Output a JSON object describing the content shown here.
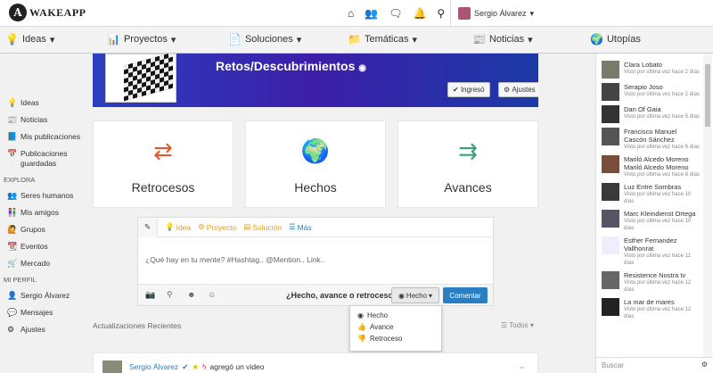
{
  "app": {
    "logo_letter": "A",
    "logo_text": "WAKEAPP"
  },
  "topbar": {
    "icons": [
      "home-icon",
      "users-icon",
      "chat-icon",
      "bell-icon",
      "search-icon"
    ],
    "user_name": "Sergio Álvarez"
  },
  "nav": [
    {
      "label": "Ideas",
      "icon": "lightbulb-icon"
    },
    {
      "label": "Proyectos",
      "icon": "chart-icon"
    },
    {
      "label": "Soluciones",
      "icon": "document-icon"
    },
    {
      "label": "Temáticas",
      "icon": "folder-icon"
    },
    {
      "label": "Noticias",
      "icon": "newspaper-icon"
    },
    {
      "label": "Utopías",
      "icon": "globe-icon"
    }
  ],
  "sidebar": {
    "items": [
      {
        "label": "Ideas",
        "icon": "💡"
      },
      {
        "label": "Noticias",
        "icon": "📰"
      },
      {
        "label": "Mis publicaciones",
        "icon": "📘"
      },
      {
        "label": "Publicaciones guardadas",
        "icon": "📅"
      }
    ],
    "explora_title": "EXPLORA",
    "explora": [
      {
        "label": "Seres humanos",
        "icon": "👥"
      },
      {
        "label": "Mis amigos",
        "icon": "👫"
      },
      {
        "label": "Grupos",
        "icon": "🙋"
      },
      {
        "label": "Eventos",
        "icon": "📆"
      },
      {
        "label": "Mercado",
        "icon": "🛒"
      }
    ],
    "perfil_title": "MI PERFIL",
    "perfil": [
      {
        "label": "Sergio Álvarez",
        "icon": "👤"
      },
      {
        "label": "Mensajes",
        "icon": "💬"
      },
      {
        "label": "Ajustes",
        "icon": "⚙"
      }
    ]
  },
  "banner": {
    "title": "Retos/Descubrimientos",
    "btn_ingreso": "Ingresó",
    "btn_ajustes": "Ajustes"
  },
  "cards": [
    {
      "label": "Retrocesos",
      "icon": "⇄"
    },
    {
      "label": "Hechos",
      "icon": "🌍"
    },
    {
      "label": "Avances",
      "icon": "⇉"
    }
  ],
  "composer": {
    "tabs": [
      {
        "label": "Idea",
        "color": "#e69b1a"
      },
      {
        "label": "Proyecto",
        "color": "#e69b1a"
      },
      {
        "label": "Solución",
        "color": "#e69b1a"
      },
      {
        "label": "Más",
        "color": "#2a7fc2"
      }
    ],
    "placeholder": "¿Qué hay en tu mente? #Hashtag.. @Mention.. Link..",
    "question": "¿Hecho, avance o retroceso?",
    "hecho_btn": "Hecho",
    "comentar": "Comentar"
  },
  "dropdown": [
    "Hecho",
    "Avance",
    "Retroceso"
  ],
  "updates": {
    "title": "Actualizaciones Recientes",
    "filter": "Todos"
  },
  "post": {
    "author": "Sergio Álvarez",
    "action": "agregó un video"
  },
  "right": {
    "users": [
      {
        "name": "Clara Lobato",
        "last": "Visto por última vez hace 2 días"
      },
      {
        "name": "Serapio Joso",
        "last": "Visto por última vez hace 2 días"
      },
      {
        "name": "Dan Of Gaia",
        "last": "Visto por última vez hace 5 días"
      },
      {
        "name": "Francisco Manuel Cascón Sánchez",
        "last": "Visto por última vez hace 6 días"
      },
      {
        "name": "Mariló Alcedo Moreno Mariló Alcedo Moreno",
        "last": "Visto por última vez hace 8 días"
      },
      {
        "name": "Luz Entre Sombras",
        "last": "Visto por última vez hace 10 días"
      },
      {
        "name": "Marc Kleindienst Ortega",
        "last": "Visto por última vez hace 10 días"
      },
      {
        "name": "Esther Fernandez Vallhonrat",
        "last": "Visto por última vez hace 11 días"
      },
      {
        "name": "Resistence Nostra tv",
        "last": "Visto por última vez hace 12 días"
      },
      {
        "name": "La mar de mares",
        "last": "Visto por última vez hace 12 días"
      }
    ],
    "search_placeholder": "Buscar"
  }
}
